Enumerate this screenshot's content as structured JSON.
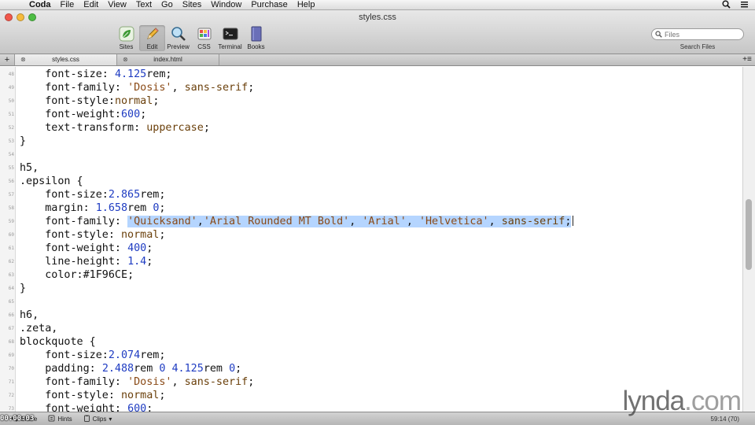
{
  "menubar": {
    "apple_glyph": "",
    "app_name": "Coda",
    "items": [
      "File",
      "Edit",
      "View",
      "Text",
      "Go",
      "Sites",
      "Window",
      "Purchase",
      "Help"
    ]
  },
  "window": {
    "title": "styles.css"
  },
  "toolbar": {
    "tools": [
      {
        "label": "Sites",
        "icon": "leaf-icon"
      },
      {
        "label": "Edit",
        "icon": "pencil-icon"
      },
      {
        "label": "Preview",
        "icon": "magnifier-icon"
      },
      {
        "label": "CSS",
        "icon": "palette-icon"
      },
      {
        "label": "Terminal",
        "icon": "terminal-icon"
      },
      {
        "label": "Books",
        "icon": "book-icon"
      }
    ],
    "active_tool": "Edit",
    "search": {
      "placeholder": "Files",
      "label": "Search Files"
    }
  },
  "tabs": [
    {
      "label": "styles.css",
      "active": true
    },
    {
      "label": "index.html",
      "active": false
    }
  ],
  "editor": {
    "lines": [
      {
        "num": "48",
        "tokens": [
          [
            "    font-size: ",
            ""
          ],
          [
            "4.125",
            "value"
          ],
          [
            "rem;",
            ""
          ]
        ]
      },
      {
        "num": "49",
        "tokens": [
          [
            "    font-family: ",
            ""
          ],
          [
            "'Dosis'",
            "string"
          ],
          [
            ", ",
            ""
          ],
          [
            "sans-serif",
            "kw"
          ],
          [
            ";",
            ""
          ]
        ]
      },
      {
        "num": "50",
        "tokens": [
          [
            "    font-style:",
            ""
          ],
          [
            "normal",
            "kw"
          ],
          [
            ";",
            ""
          ]
        ]
      },
      {
        "num": "51",
        "tokens": [
          [
            "    font-weight:",
            ""
          ],
          [
            "600",
            "value"
          ],
          [
            ";",
            ""
          ]
        ]
      },
      {
        "num": "52",
        "tokens": [
          [
            "    text-transform: ",
            ""
          ],
          [
            "uppercase",
            "kw"
          ],
          [
            ";",
            ""
          ]
        ]
      },
      {
        "num": "53",
        "tokens": [
          [
            "}",
            ""
          ]
        ]
      },
      {
        "num": "54",
        "tokens": []
      },
      {
        "num": "55",
        "tokens": [
          [
            "h5,",
            ""
          ]
        ]
      },
      {
        "num": "56",
        "tokens": [
          [
            ".epsilon {",
            ""
          ]
        ]
      },
      {
        "num": "57",
        "tokens": [
          [
            "    font-size:",
            ""
          ],
          [
            "2.865",
            "value"
          ],
          [
            "rem;",
            ""
          ]
        ]
      },
      {
        "num": "58",
        "tokens": [
          [
            "    margin: ",
            ""
          ],
          [
            "1.658",
            "value"
          ],
          [
            "rem ",
            ""
          ],
          [
            "0",
            "value"
          ],
          [
            ";",
            ""
          ]
        ]
      },
      {
        "num": "59",
        "tokens": [
          [
            "    font-family: ",
            ""
          ],
          [
            "'Quicksand'",
            "string sel"
          ],
          [
            ",",
            "sel"
          ],
          [
            "'Arial Rounded MT Bold'",
            "string sel"
          ],
          [
            ", ",
            "sel"
          ],
          [
            "'Arial'",
            "string sel"
          ],
          [
            ", ",
            "sel"
          ],
          [
            "'Helvetica'",
            "string sel"
          ],
          [
            ", ",
            "sel"
          ],
          [
            "sans-serif",
            "kw sel"
          ],
          [
            ";",
            "sel"
          ],
          [
            "",
            "cursor"
          ]
        ]
      },
      {
        "num": "60",
        "tokens": [
          [
            "    font-style: ",
            ""
          ],
          [
            "normal",
            "kw"
          ],
          [
            ";",
            ""
          ]
        ]
      },
      {
        "num": "61",
        "tokens": [
          [
            "    font-weight: ",
            ""
          ],
          [
            "400",
            "value"
          ],
          [
            ";",
            ""
          ]
        ]
      },
      {
        "num": "62",
        "tokens": [
          [
            "    line-height: ",
            ""
          ],
          [
            "1.4",
            "value"
          ],
          [
            ";",
            ""
          ]
        ]
      },
      {
        "num": "63",
        "tokens": [
          [
            "    color:",
            ""
          ],
          [
            "#1F96CE",
            ""
          ],
          [
            ";",
            ""
          ]
        ]
      },
      {
        "num": "64",
        "tokens": [
          [
            "}",
            ""
          ]
        ]
      },
      {
        "num": "65",
        "tokens": []
      },
      {
        "num": "66",
        "tokens": [
          [
            "h6,",
            ""
          ]
        ]
      },
      {
        "num": "67",
        "tokens": [
          [
            ".zeta,",
            ""
          ]
        ]
      },
      {
        "num": "68",
        "tokens": [
          [
            "blockquote {",
            ""
          ]
        ]
      },
      {
        "num": "69",
        "tokens": [
          [
            "    font-size:",
            ""
          ],
          [
            "2.074",
            "value"
          ],
          [
            "rem;",
            ""
          ]
        ]
      },
      {
        "num": "70",
        "tokens": [
          [
            "    padding: ",
            ""
          ],
          [
            "2.488",
            "value"
          ],
          [
            "rem ",
            ""
          ],
          [
            "0",
            "value"
          ],
          [
            " ",
            ""
          ],
          [
            "4.125",
            "value"
          ],
          [
            "rem ",
            ""
          ],
          [
            "0",
            "value"
          ],
          [
            ";",
            ""
          ]
        ]
      },
      {
        "num": "71",
        "tokens": [
          [
            "    font-family: ",
            ""
          ],
          [
            "'Dosis'",
            "string"
          ],
          [
            ", ",
            ""
          ],
          [
            "sans-serif",
            "kw"
          ],
          [
            ";",
            ""
          ]
        ]
      },
      {
        "num": "72",
        "tokens": [
          [
            "    font-style: ",
            ""
          ],
          [
            "normal",
            "kw"
          ],
          [
            ";",
            ""
          ]
        ]
      },
      {
        "num": "73",
        "tokens": [
          [
            "    font-weight: ",
            ""
          ],
          [
            "600",
            "value"
          ],
          [
            ";",
            ""
          ]
        ]
      }
    ]
  },
  "statusbar": {
    "timecode": "00:00:03",
    "items": [
      {
        "label": "Share",
        "icon": "share-icon"
      },
      {
        "label": "Hints",
        "icon": "hints-icon"
      },
      {
        "label": "Clips",
        "icon": "clips-icon"
      }
    ],
    "cursor_position": "59:14 (70)"
  },
  "watermark": {
    "brand": "lynda",
    "suffix": ".com"
  },
  "colors": {
    "selection": "#b5d5ff",
    "number": "#1f3cc2",
    "string": "#8a4a16"
  }
}
